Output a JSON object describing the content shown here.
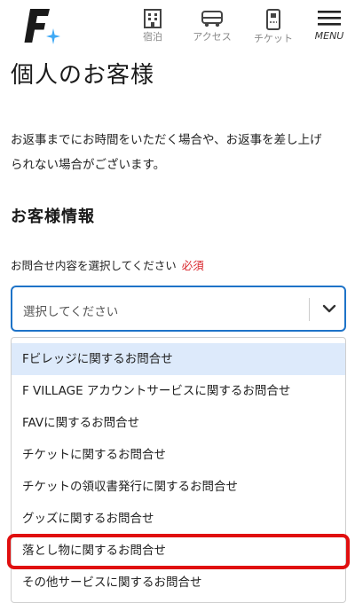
{
  "header": {
    "nav": [
      {
        "label": "宿泊",
        "icon": "hotel-building-icon"
      },
      {
        "label": "アクセス",
        "icon": "bus-icon"
      },
      {
        "label": "チケット",
        "icon": "ticket-icon"
      },
      {
        "label": "MENU",
        "icon": "hamburger-menu-icon"
      }
    ],
    "brand_colors": {
      "logo_dark": "#1a1a1a",
      "logo_star": "#3fa9f5"
    }
  },
  "page": {
    "title": "個人のお客様",
    "notice_line1": "お返事までにお時間をいただく場合や、お返事を差し上げ",
    "notice_line2": "られない場合がございます。",
    "section_heading": "お客様情報"
  },
  "form": {
    "inquiry_label": "お問合せ内容を選択してください",
    "required_label": "必須",
    "select_placeholder": "選択してください",
    "options": [
      "Fビレッジに関するお問合せ",
      "F VILLAGE アカウントサービスに関するお問合せ",
      "FAVに関するお問合せ",
      "チケットに関するお問合せ",
      "チケットの領収書発行に関するお問合せ",
      "グッズに関するお問合せ",
      "落とし物に関するお問合せ",
      "その他サービスに関するお問合せ"
    ],
    "hovered_option": "Fビレッジに関するお問合せ",
    "highlighted_option": "落とし物に関するお問合せ"
  },
  "colors": {
    "accent_blue": "#1e73c8",
    "hover_bg": "#ddeafb",
    "required_red": "#d9262c",
    "highlight_red": "#e00f0f"
  }
}
